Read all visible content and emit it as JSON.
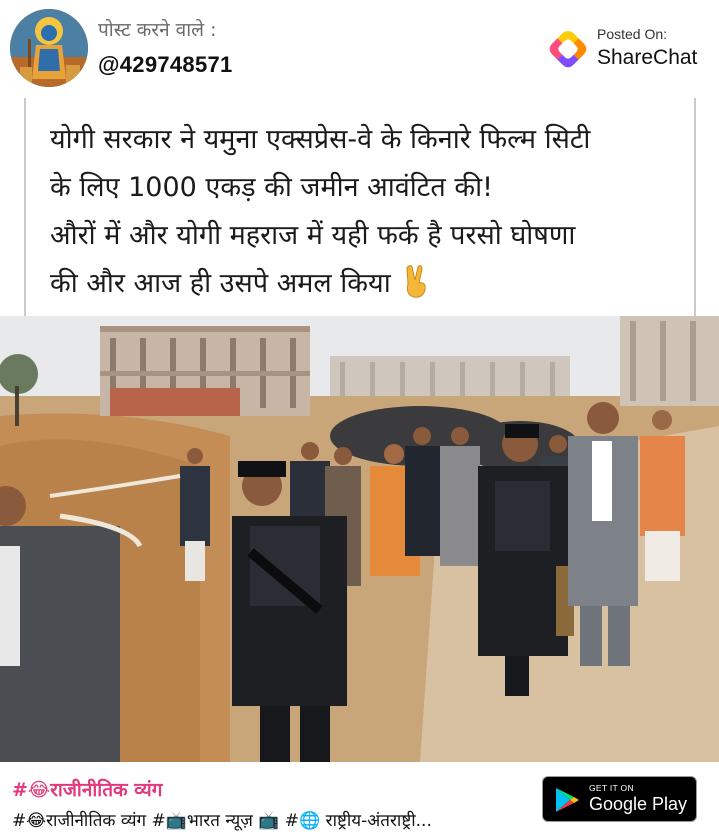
{
  "header": {
    "poster_label": "पोस्ट करने वाले :",
    "poster_handle": "@429748571",
    "posted_on_label": "Posted On:",
    "brand_name": "ShareChat",
    "avatar_icon": "deity-avatar-icon",
    "logo_icon": "sharechat-logo-icon"
  },
  "caption": {
    "line1": "योगी सरकार ने यमुना एक्सप्रेस-वे के किनारे फिल्म सिटी",
    "line2": "के लिए 1000 एकड़ की जमीन आवंटित की!",
    "line3": "औरों में और योगी महराज में यही फर्क है परसो घोषणा",
    "line4": "की और आज ही उसपे अमल किया",
    "emoji": "victory-hand-icon"
  },
  "photo": {
    "description_icon": "news-photo"
  },
  "footer": {
    "primary_tag": "#😂राजीनीतिक व्यंग",
    "tags_line": "#😂राजीनीतिक व्यंग #📺भारत न्यूज़ 📺 #🌐 राष्ट्रीय-अंतराष्ट्री...",
    "store_badge": {
      "small": "GET IT ON",
      "big": "Google Play"
    }
  },
  "colors": {
    "tag_pink": "#e23a7a",
    "badge_bg": "#000000"
  }
}
